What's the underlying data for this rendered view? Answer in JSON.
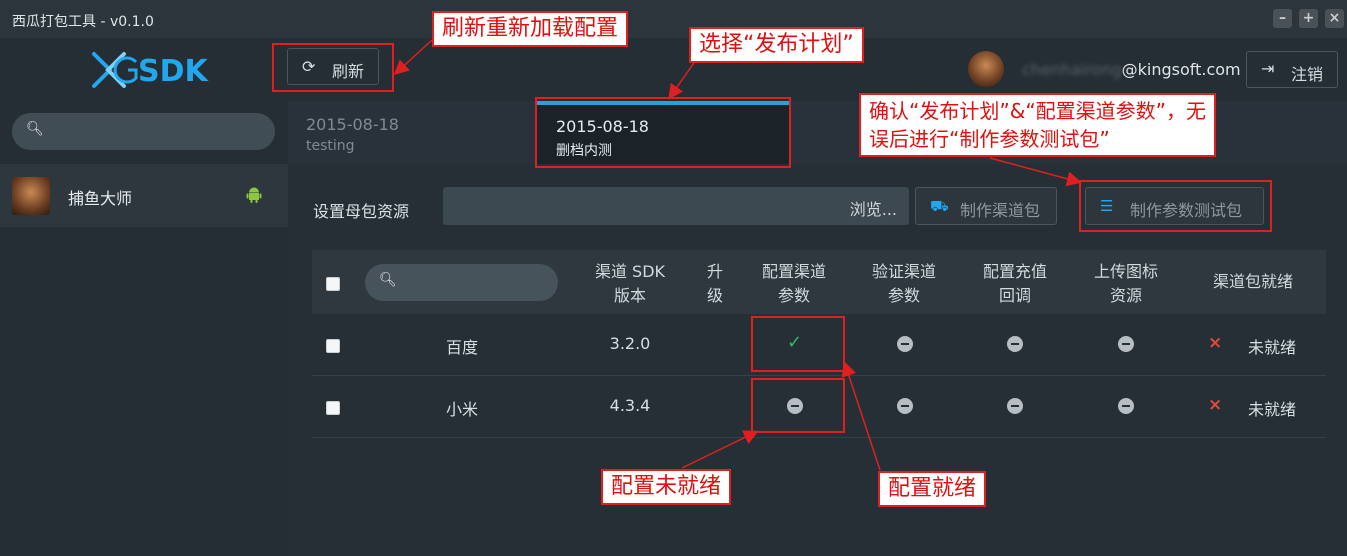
{
  "window": {
    "title": "西瓜打包工具 - v0.1.0"
  },
  "header": {
    "logo_text": "SDK",
    "refresh_label": "刷新",
    "user_blurred": "chenhairong",
    "user_domain": "@kingsoft.com",
    "logout_label": "注销"
  },
  "sidebar": {
    "games": [
      {
        "name": "捕鱼大师"
      }
    ]
  },
  "plans": [
    {
      "date": "2015-08-18",
      "subtitle": "testing"
    },
    {
      "date": "2015-08-18",
      "subtitle": "删档内测"
    }
  ],
  "toolbar": {
    "base_label": "设置母包资源",
    "browse_label": "浏览...",
    "make_channel_label": "制作渠道包",
    "make_test_label": "制作参数测试包"
  },
  "table": {
    "headers": {
      "sdk_version": "渠道 SDK 版本",
      "upgrade": "升级",
      "config_params": "配置渠道参数",
      "verify_params": "验证渠道参数",
      "recharge_callback": "配置充值回调",
      "upload_icon": "上传图标资源",
      "ready": "渠道包就绪"
    },
    "rows": [
      {
        "name": "百度",
        "version": "3.2.0",
        "config": "ok",
        "ready": "未就绪"
      },
      {
        "name": "小米",
        "version": "4.3.4",
        "config": "pending",
        "ready": "未就绪"
      }
    ]
  },
  "annotations": {
    "refresh": "刷新重新加载配置",
    "select_plan": "选择“发布计划”",
    "confirm_line1": "确认“发布计划”&“配置渠道参数”，无",
    "confirm_line2": "误后进行“制作参数测试包”",
    "not_ready": "配置未就绪",
    "ready": "配置就绪"
  },
  "colors": {
    "accent": "#22a6ee",
    "annotation": "#e02020",
    "ok": "#2fb86a",
    "error": "#e04a3c"
  }
}
